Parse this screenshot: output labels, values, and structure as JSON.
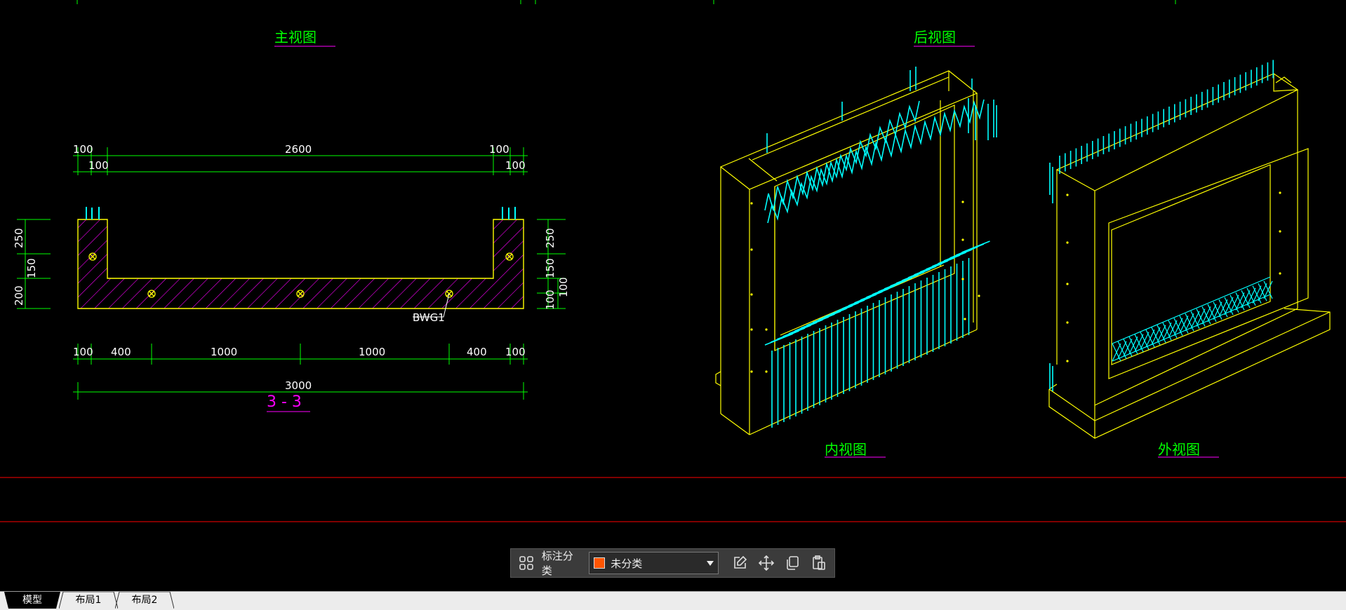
{
  "drawing": {
    "titles": {
      "front_view": "主视图",
      "back_view": "后视图",
      "inner_view": "内视图",
      "outer_view": "外视图",
      "section": "3 - 3"
    },
    "dims_top": {
      "a": "100",
      "b": "100",
      "mid": "2600",
      "c": "100",
      "d": "100"
    },
    "dims_left": {
      "a": "250",
      "b": "150",
      "c": "200"
    },
    "dims_right": {
      "a": "250",
      "b": "150",
      "c": "100",
      "d": "100"
    },
    "dims_bottom": {
      "a": "100",
      "b": "400",
      "c": "1000",
      "d": "1000",
      "e": "400",
      "f": "100"
    },
    "dim_total": "3000",
    "rebar_label": "BWG1",
    "colors": {
      "outline": "#ffff00",
      "rebar": "#00ffff",
      "dim": "#00ff00",
      "hatch": "#ff00ff",
      "red_line": "#ff0000"
    }
  },
  "toolbar": {
    "category_label": "标注分类",
    "selected_category": "未分类",
    "swatch_color": "#ff5500",
    "icons": [
      "grid-icon",
      "edit-icon",
      "move-icon",
      "copy-icon",
      "paste-icon"
    ]
  },
  "tabs": [
    {
      "label": "模型",
      "active": true
    },
    {
      "label": "布局1",
      "active": false
    },
    {
      "label": "布局2",
      "active": false
    }
  ]
}
